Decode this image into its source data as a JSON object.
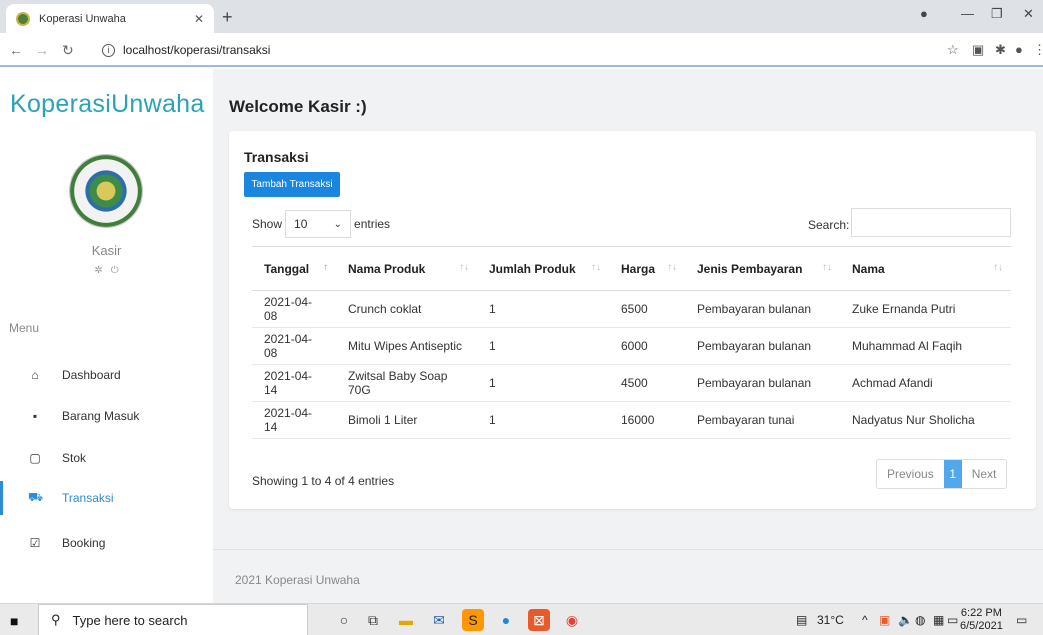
{
  "browser": {
    "tab_title": "Koperasi Unwaha",
    "url": "localhost/koperasi/transaksi"
  },
  "sidebar": {
    "brand": "KoperasiUnwaha",
    "role": "Kasir",
    "menu_label": "Menu",
    "items": [
      {
        "label": "Dashboard",
        "icon": "home-icon"
      },
      {
        "label": "Barang Masuk",
        "icon": "briefcase-icon"
      },
      {
        "label": "Stok",
        "icon": "clipboard-icon"
      },
      {
        "label": "Transaksi",
        "icon": "cart-icon",
        "active": true
      },
      {
        "label": "Booking",
        "icon": "checkbox-icon"
      }
    ]
  },
  "main": {
    "welcome": "Welcome Kasir :)",
    "card_title": "Transaksi",
    "add_button": "Tambah Transaksi",
    "show_label": "Show",
    "entries_value": "10",
    "entries_label": "entries",
    "search_label": "Search:",
    "table": {
      "headers": [
        "Tanggal",
        "Nama Produk",
        "Jumlah Produk",
        "Harga",
        "Jenis Pembayaran",
        "Nama"
      ],
      "rows": [
        [
          "2021-04-08",
          "Crunch coklat",
          "1",
          "6500",
          "Pembayaran bulanan",
          "Zuke Ernanda Putri"
        ],
        [
          "2021-04-08",
          "Mitu Wipes Antiseptic",
          "1",
          "6000",
          "Pembayaran bulanan",
          "Muhammad Al Faqih"
        ],
        [
          "2021-04-14",
          "Zwitsal Baby Soap 70G",
          "1",
          "4500",
          "Pembayaran bulanan",
          "Achmad Afandi"
        ],
        [
          "2021-04-14",
          "Bimoli 1 Liter",
          "1",
          "16000",
          "Pembayaran tunai",
          "Nadyatus Nur Sholicha"
        ]
      ]
    },
    "info": "Showing 1 to 4 of 4 entries",
    "pager": {
      "previous": "Previous",
      "current": "1",
      "next": "Next"
    },
    "footer": "2021 Koperasi Unwaha"
  },
  "taskbar": {
    "search_placeholder": "Type here to search",
    "weather": "31°C",
    "time": "6:22 PM",
    "date": "6/5/2021"
  },
  "colors": {
    "accent": "#1a86e0",
    "brand": "#2aa3b8"
  }
}
